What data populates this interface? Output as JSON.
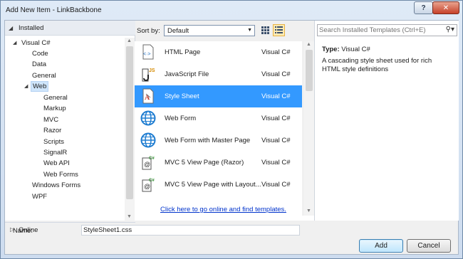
{
  "window": {
    "title": "Add New Item - LinkBackbone",
    "help_label": "?",
    "close_label": "✕"
  },
  "tree": {
    "installed_label": "Installed",
    "items": [
      {
        "label": "Visual C#",
        "level": 0,
        "expanded": true
      },
      {
        "label": "Code",
        "level": 1
      },
      {
        "label": "Data",
        "level": 1
      },
      {
        "label": "General",
        "level": 1
      },
      {
        "label": "Web",
        "level": 1,
        "expanded": true,
        "selected": true
      },
      {
        "label": "General",
        "level": 2
      },
      {
        "label": "Markup",
        "level": 2
      },
      {
        "label": "MVC",
        "level": 2
      },
      {
        "label": "Razor",
        "level": 2
      },
      {
        "label": "Scripts",
        "level": 2
      },
      {
        "label": "SignalR",
        "level": 2
      },
      {
        "label": "Web API",
        "level": 2
      },
      {
        "label": "Web Forms",
        "level": 2
      },
      {
        "label": "Windows Forms",
        "level": 1
      },
      {
        "label": "WPF",
        "level": 1
      }
    ],
    "online_label": "Online"
  },
  "toolbar": {
    "sort_by_label": "Sort by:",
    "sort_value": "Default"
  },
  "templates": [
    {
      "name": "HTML Page",
      "lang": "Visual C#",
      "icon": "html-page-icon"
    },
    {
      "name": "JavaScript File",
      "lang": "Visual C#",
      "icon": "javascript-file-icon"
    },
    {
      "name": "Style Sheet",
      "lang": "Visual C#",
      "icon": "style-sheet-icon",
      "selected": true
    },
    {
      "name": "Web Form",
      "lang": "Visual C#",
      "icon": "web-form-icon"
    },
    {
      "name": "Web Form with Master Page",
      "lang": "Visual C#",
      "icon": "web-form-master-icon"
    },
    {
      "name": "MVC 5 View Page (Razor)",
      "lang": "Visual C#",
      "icon": "mvc-view-icon"
    },
    {
      "name": "MVC 5 View Page with Layout...",
      "lang": "Visual C#",
      "icon": "mvc-view-layout-icon"
    }
  ],
  "online_link": "Click here to go online and find templates.",
  "details": {
    "search_placeholder": "Search Installed Templates (Ctrl+E)",
    "type_label": "Type:",
    "type_value": "Visual C#",
    "description": "A cascading style sheet used for rich HTML style definitions"
  },
  "footer": {
    "name_label": "Name:",
    "name_value": "StyleSheet1.css",
    "add_label": "Add",
    "cancel_label": "Cancel"
  },
  "colors": {
    "selection": "#3399ff",
    "link": "#0033cc",
    "tree_selection": "#cfe5fb"
  }
}
